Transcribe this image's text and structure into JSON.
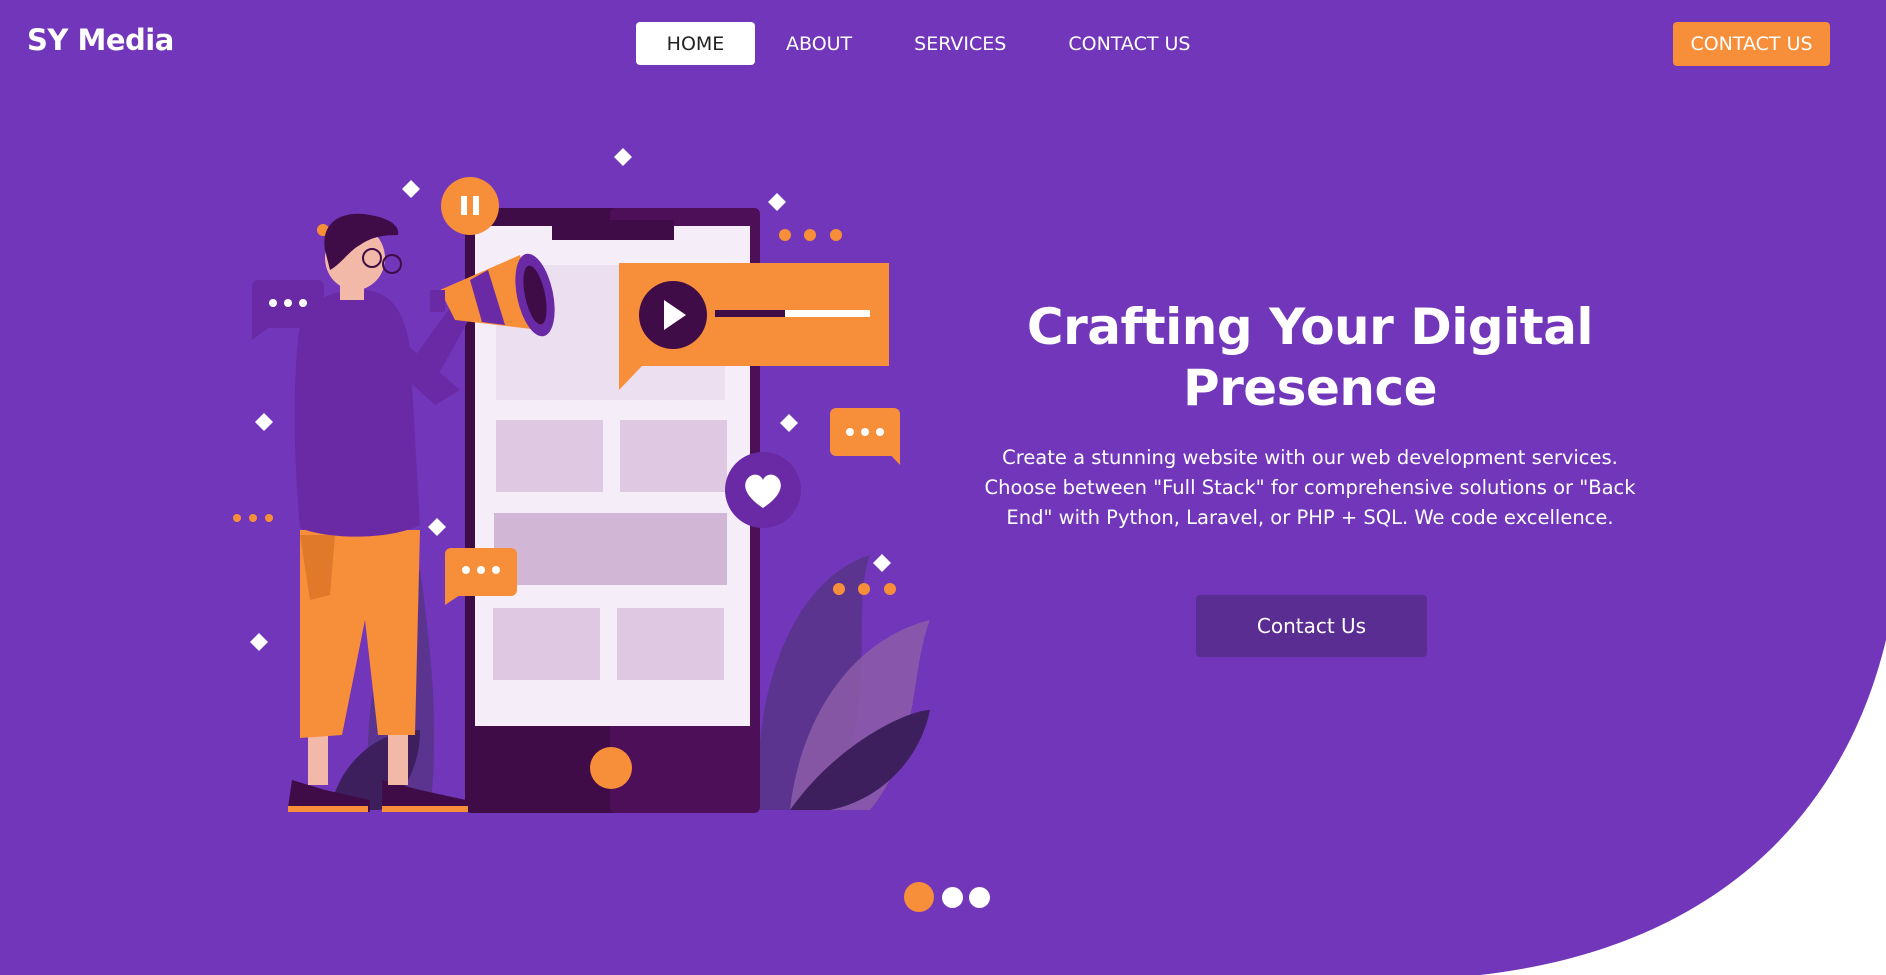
{
  "brand": {
    "name": "SY Media"
  },
  "colors": {
    "background": "#7136b9",
    "accent": "#f78e3a",
    "button_dark": "#5a2d92",
    "white": "#ffffff"
  },
  "nav": {
    "items": [
      {
        "label": "HOME",
        "active": true
      },
      {
        "label": "ABOUT",
        "active": false
      },
      {
        "label": "SERVICES",
        "active": false
      },
      {
        "label": "CONTACT US",
        "active": false
      }
    ]
  },
  "header": {
    "cta_label": "CONTACT US"
  },
  "hero": {
    "title": "Crafting Your Digital Presence",
    "description": "Create a stunning website with our web development services. Choose between \"Full Stack\" for comprehensive solutions or \"Back End\" with Python, Laravel, or PHP + SQL. We code excellence.",
    "cta_label": "Contact Us"
  },
  "carousel": {
    "slide_count": 3,
    "active_index": 0
  },
  "icons": [
    "pause-icon",
    "play-icon",
    "heart-icon",
    "megaphone-icon",
    "chat-bubble-icon"
  ]
}
